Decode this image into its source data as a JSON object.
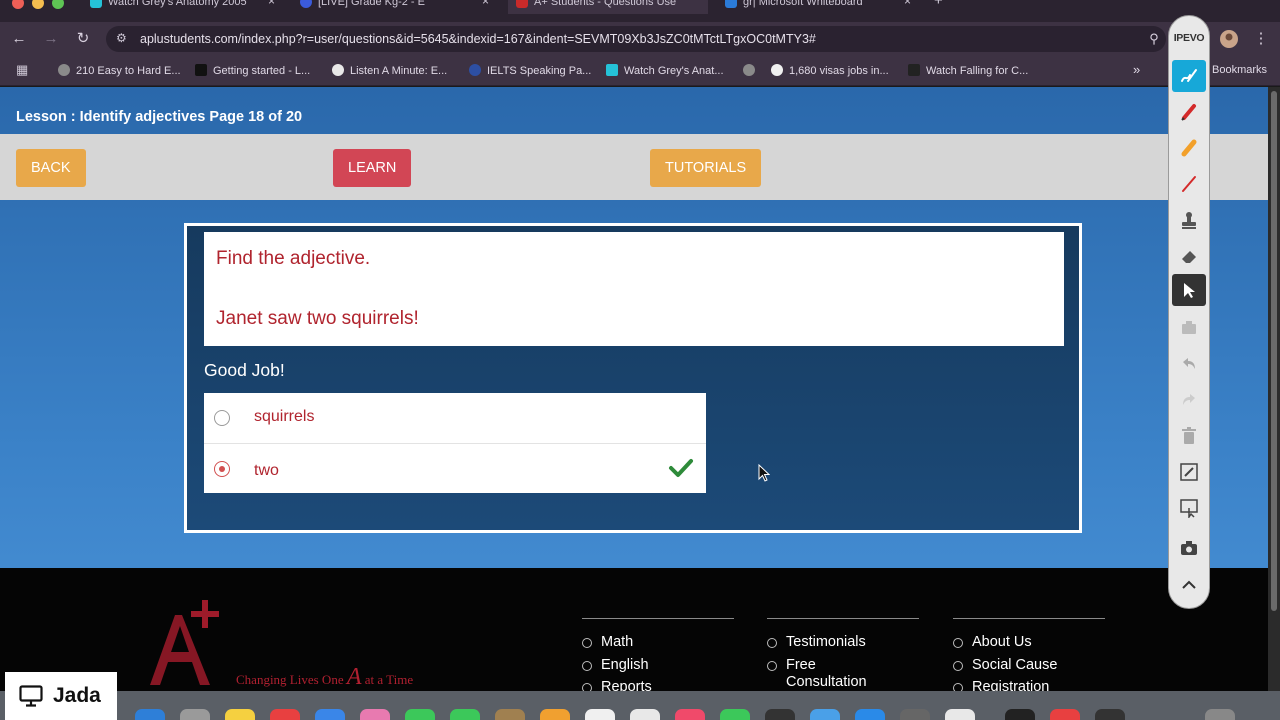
{
  "browser": {
    "tabs": [
      {
        "title": "Watch Grey's Anatomy 2005",
        "active": false
      },
      {
        "title": "[LIVE] Grade Kg-2 - E",
        "active": false
      },
      {
        "title": "A+ Students - Questions Use",
        "active": true
      },
      {
        "title": "gr| Microsoft Whiteboard",
        "active": false
      }
    ],
    "new_tab": "+",
    "url": "aplustudents.com/index.php?r=user/questions&id=5645&indexid=167&indent=SEVMT09Xb3JsZC0tMTctLTgxOC0tMTY3#",
    "bookmarks": [
      "210 Easy to Hard E...",
      "Getting started - L...",
      "Listen A Minute: E...",
      "IELTS Speaking Pa...",
      "Watch Grey's Anat...",
      "",
      "1,680 visas jobs in...",
      "Watch Falling for C..."
    ],
    "bookmarks_more": "»",
    "bookmarks_folder": "Bookmarks"
  },
  "lesson": {
    "title": "Lesson : Identify adjectives Page 18 of 20",
    "buttons": {
      "back": "BACK",
      "learn": "LEARN",
      "tutorials": "TUTORIALS"
    }
  },
  "question": {
    "prompt": "Find the adjective.",
    "sentence": "Janet saw two squirrels!",
    "feedback": "Good Job!",
    "options": [
      {
        "label": "squirrels",
        "selected": false,
        "correct": false
      },
      {
        "label": "two",
        "selected": true,
        "correct": true
      }
    ]
  },
  "footer": {
    "tagline_pre": "Changing Lives One",
    "tagline_mid": "A",
    "tagline_post": "at a Time",
    "col1": [
      "Math",
      "English",
      "Reports"
    ],
    "col2": [
      "Testimonials",
      "Free",
      "Consultation"
    ],
    "col3": [
      "About Us",
      "Social Cause",
      "Registration"
    ]
  },
  "ipevo": {
    "logo": "IPEVO"
  },
  "overlay": {
    "presenter": "Jada"
  },
  "colors": {
    "page_blue": "#3b82c8",
    "button_orange": "#e8a84a",
    "button_red": "#d24655",
    "question_text": "#b0242e",
    "correct_green": "#2e8b3a"
  }
}
